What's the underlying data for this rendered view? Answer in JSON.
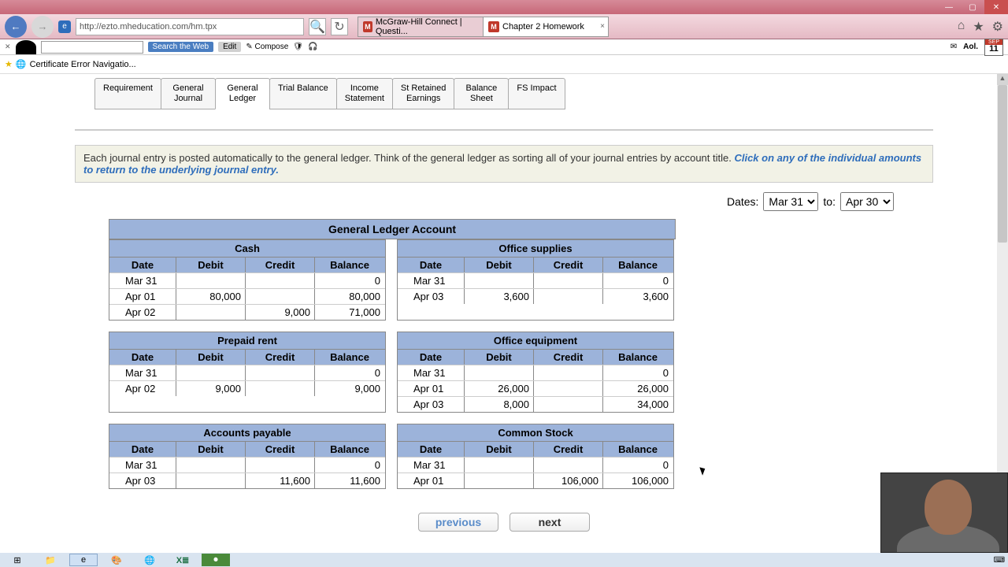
{
  "window": {
    "minimize": "—",
    "maximize": "▢",
    "close": "✕"
  },
  "browser": {
    "url": "http://ezto.mheducation.com/hm.tpx",
    "back": "←",
    "forward": "→",
    "refresh": "↻",
    "tabs": [
      {
        "title": "McGraw-Hill Connect | Questi...",
        "icon": "M"
      },
      {
        "title": "Chapter 2 Homework",
        "icon": "M",
        "close": "×"
      }
    ],
    "home_icon": "⌂",
    "star_icon": "★",
    "gear_icon": "⚙"
  },
  "aolbar": {
    "search_btn": "Search the Web",
    "edit_btn": "Edit",
    "compose": "Compose",
    "date_month": "SEP",
    "date_day": "11",
    "aol_text": "Aol."
  },
  "bookmarks": {
    "item1": "Certificate Error Navigatio..."
  },
  "content_tabs": [
    "Requirement",
    "General\nJournal",
    "General\nLedger",
    "Trial Balance",
    "Income\nStatement",
    "St Retained\nEarnings",
    "Balance\nSheet",
    "FS Impact"
  ],
  "instruction": {
    "text1": "Each journal entry is posted automatically to the general ledger.   Think of the general ledger as sorting all of your journal entries by account title.  ",
    "link": "Click on any of the individual amounts to return to the underlying journal entry."
  },
  "dates": {
    "label": "Dates:",
    "from": "Mar 31",
    "to_label": "to:",
    "to": "Apr 30"
  },
  "ledger_header": "General Ledger Account",
  "col": {
    "date": "Date",
    "debit": "Debit",
    "credit": "Credit",
    "balance": "Balance"
  },
  "chart_data": {
    "type": "table",
    "accounts": [
      {
        "name": "Cash",
        "rows": [
          {
            "date": "Mar 31",
            "debit": "",
            "credit": "",
            "balance": "0"
          },
          {
            "date": "Apr 01",
            "debit": "80,000",
            "credit": "",
            "balance": "80,000"
          },
          {
            "date": "Apr 02",
            "debit": "",
            "credit": "9,000",
            "balance": "71,000"
          }
        ]
      },
      {
        "name": "Office supplies",
        "rows": [
          {
            "date": "Mar 31",
            "debit": "",
            "credit": "",
            "balance": "0"
          },
          {
            "date": "Apr 03",
            "debit": "3,600",
            "credit": "",
            "balance": "3,600"
          }
        ]
      },
      {
        "name": "Prepaid rent",
        "rows": [
          {
            "date": "Mar 31",
            "debit": "",
            "credit": "",
            "balance": "0"
          },
          {
            "date": "Apr 02",
            "debit": "9,000",
            "credit": "",
            "balance": "9,000"
          }
        ]
      },
      {
        "name": "Office equipment",
        "rows": [
          {
            "date": "Mar 31",
            "debit": "",
            "credit": "",
            "balance": "0"
          },
          {
            "date": "Apr 01",
            "debit": "26,000",
            "credit": "",
            "balance": "26,000"
          },
          {
            "date": "Apr 03",
            "debit": "8,000",
            "credit": "",
            "balance": "34,000"
          }
        ]
      },
      {
        "name": "Accounts payable",
        "rows": [
          {
            "date": "Mar 31",
            "debit": "",
            "credit": "",
            "balance": "0"
          },
          {
            "date": "Apr 03",
            "debit": "",
            "credit": "11,600",
            "balance": "11,600"
          }
        ]
      },
      {
        "name": "Common Stock",
        "rows": [
          {
            "date": "Mar 31",
            "debit": "",
            "credit": "",
            "balance": "0"
          },
          {
            "date": "Apr 01",
            "debit": "",
            "credit": "106,000",
            "balance": "106,000"
          }
        ]
      }
    ]
  },
  "nav": {
    "prev": "previous",
    "next": "next"
  }
}
